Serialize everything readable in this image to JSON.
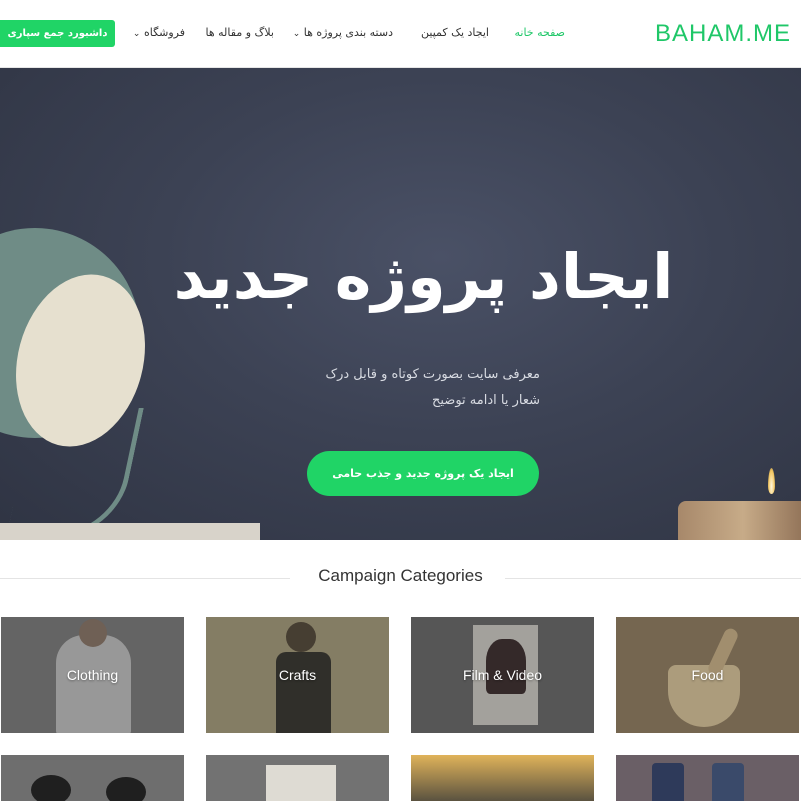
{
  "header": {
    "logo": "BAHAM.ME",
    "nav": {
      "home": "صفحه خانه",
      "create_campaign": "ایجاد یک کمپین",
      "project_categories": "دسته بندی پروژه ها",
      "blog": "بلاگ و مقاله ها",
      "shop": "فروشگاه"
    },
    "dashboard_button": "داشبورد جمع سپاری"
  },
  "hero": {
    "title": "ایجاد پروژه جدید",
    "description_line1": "معرفی سایت بصورت کوتاه و قابل درک",
    "description_line2": "شعار یا ادامه توضیح",
    "cta": "ایجاد یک پروژه جدید و جذب حامی"
  },
  "categories": {
    "heading": "Campaign Categories",
    "items": [
      "Clothing",
      "Crafts",
      "Film & Video",
      "Food"
    ]
  },
  "colors": {
    "accent": "#20d466",
    "logo": "#1fc768",
    "hero_bg": "#3c4254"
  }
}
